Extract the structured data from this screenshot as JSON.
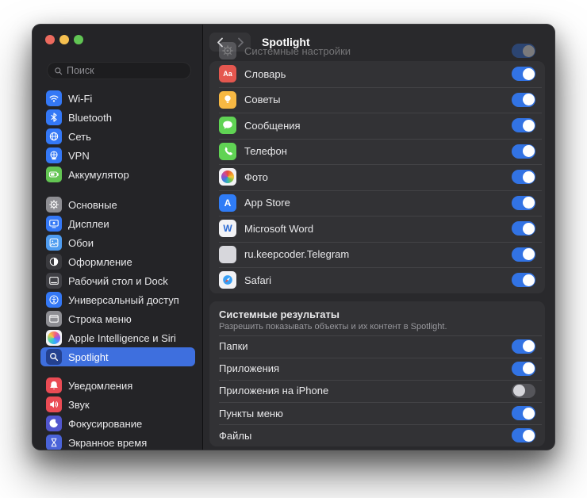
{
  "window": {
    "controls": [
      "close",
      "minimize",
      "zoom"
    ]
  },
  "colors": {
    "accent_blue": "#3e6fde",
    "toggle_on": "#3273e4",
    "toggle_off": "#55555a",
    "window_bg": "#29292c",
    "sidebar_bg": "#242427",
    "card_bg": "#323235",
    "text_primary": "#e8e8ea",
    "text_secondary": "#98989d",
    "traffic_red": "#ec6a5e",
    "traffic_yellow": "#f5bf4f",
    "traffic_green": "#61c554"
  },
  "sidebar": {
    "search": {
      "placeholder": "Поиск",
      "icon": "search-icon"
    },
    "items": [
      {
        "label": "Wi-Fi",
        "icon": "wifi-icon"
      },
      {
        "label": "Bluetooth",
        "icon": "bluetooth-icon"
      },
      {
        "label": "Сеть",
        "icon": "network-globe-icon"
      },
      {
        "label": "VPN",
        "icon": "vpn-globe-icon"
      },
      {
        "label": "Аккумулятор",
        "icon": "battery-icon"
      },
      {
        "label": "Основные",
        "icon": "gear-icon"
      },
      {
        "label": "Дисплеи",
        "icon": "display-icon"
      },
      {
        "label": "Обои",
        "icon": "wallpaper-icon"
      },
      {
        "label": "Оформление",
        "icon": "appearance-icon"
      },
      {
        "label": "Рабочий стол и Dock",
        "icon": "desktop-dock-icon"
      },
      {
        "label": "Универсальный доступ",
        "icon": "accessibility-icon"
      },
      {
        "label": "Строка меню",
        "icon": "menu-bar-icon"
      },
      {
        "label": "Apple Intelligence и Siri",
        "icon": "siri-icon"
      },
      {
        "label": "Spotlight",
        "icon": "spotlight-icon",
        "selected": true
      },
      {
        "label": "Уведомления",
        "icon": "bell-icon"
      },
      {
        "label": "Звук",
        "icon": "speaker-icon"
      },
      {
        "label": "Фокусирование",
        "icon": "moon-icon"
      },
      {
        "label": "Экранное время",
        "icon": "hourglass-icon"
      }
    ]
  },
  "content": {
    "toolbar": {
      "title": "Spotlight",
      "back_icon": "chevron-left-icon",
      "forward_icon": "chevron-right-icon"
    },
    "scrolled_row": {
      "label": "Системные настройки",
      "icon": "gear-icon",
      "on": true
    },
    "search_results": [
      {
        "label": "Словарь",
        "icon": "dictionary-icon",
        "glyph": "Аа",
        "on": true
      },
      {
        "label": "Советы",
        "icon": "tips-icon",
        "on": true
      },
      {
        "label": "Сообщения",
        "icon": "messages-icon",
        "on": true
      },
      {
        "label": "Телефон",
        "icon": "phone-icon",
        "on": true
      },
      {
        "label": "Фото",
        "icon": "photos-icon",
        "on": true
      },
      {
        "label": "App Store",
        "icon": "app-store-icon",
        "glyph": "A",
        "on": true
      },
      {
        "label": "Microsoft Word",
        "icon": "word-icon",
        "glyph": "W",
        "on": true
      },
      {
        "label": "ru.keepcoder.Telegram",
        "icon": "telegram-icon",
        "on": true
      },
      {
        "label": "Safari",
        "icon": "safari-icon",
        "on": true
      }
    ],
    "system_results": {
      "title": "Системные результаты",
      "subtitle": "Разрешить показывать объекты и их контент в Spotlight.",
      "rows": [
        {
          "label": "Папки",
          "on": true
        },
        {
          "label": "Приложения",
          "on": true
        },
        {
          "label": "Приложения на iPhone",
          "on": false
        },
        {
          "label": "Пункты меню",
          "on": true
        },
        {
          "label": "Файлы",
          "on": true
        }
      ]
    }
  }
}
